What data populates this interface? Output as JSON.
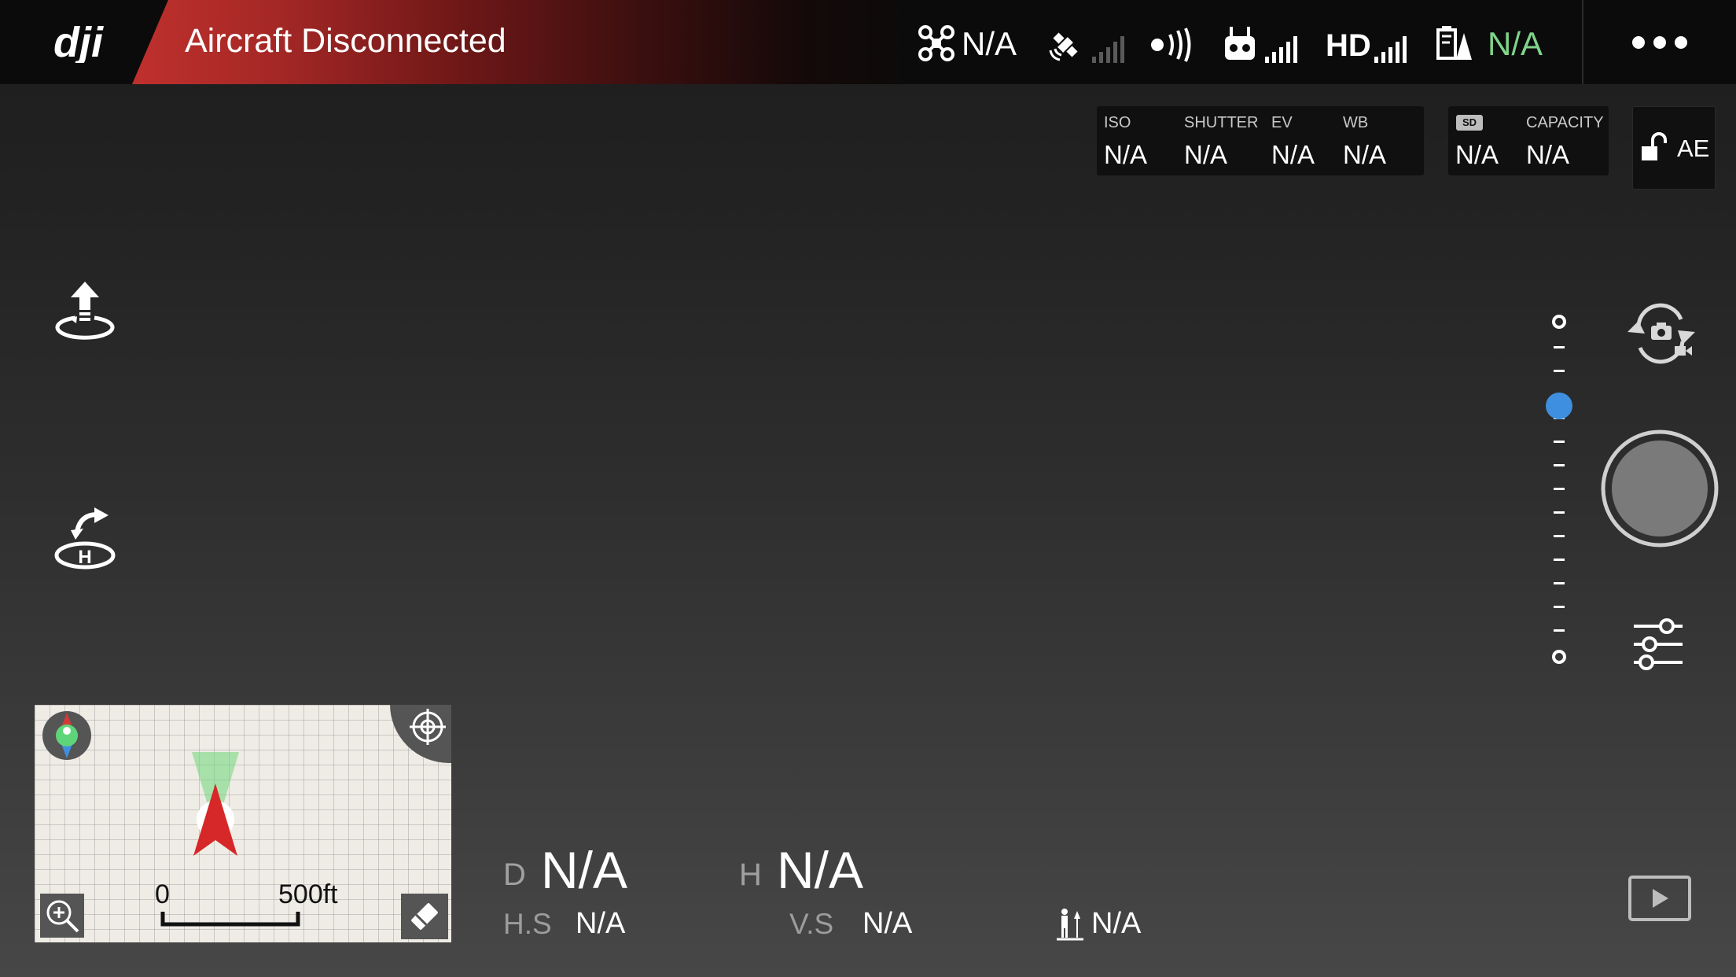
{
  "top_bar": {
    "logo_text": "dji",
    "status": "Aircraft Disconnected",
    "aircraft_value": "N/A",
    "hd_label": "HD",
    "battery_value": "N/A",
    "battery_color": "#7fd48a"
  },
  "camera_params": {
    "iso": {
      "label": "ISO",
      "value": "N/A"
    },
    "shutter": {
      "label": "SHUTTER",
      "value": "N/A"
    },
    "ev": {
      "label": "EV",
      "value": "N/A"
    },
    "wb": {
      "label": "WB",
      "value": "N/A"
    },
    "sd": {
      "badge": "SD",
      "value": "N/A"
    },
    "capacity": {
      "label": "CAPACITY",
      "value": "N/A"
    },
    "ae_lock": "AE"
  },
  "map": {
    "scale_start": "0",
    "scale_end": "500ft"
  },
  "telemetry": {
    "distance": {
      "label": "D",
      "value": "N/A"
    },
    "height": {
      "label": "H",
      "value": "N/A"
    },
    "horizontal_speed": {
      "label": "H.S",
      "value": "N/A"
    },
    "vertical_speed": {
      "label": "V.S",
      "value": "N/A"
    },
    "vps_height": {
      "value": "N/A"
    }
  },
  "colors": {
    "banner_red": "#bf302d",
    "slider_accent": "#3f8fe0",
    "signal_active": "#ffffff",
    "signal_inactive": "#5a5a5a"
  }
}
